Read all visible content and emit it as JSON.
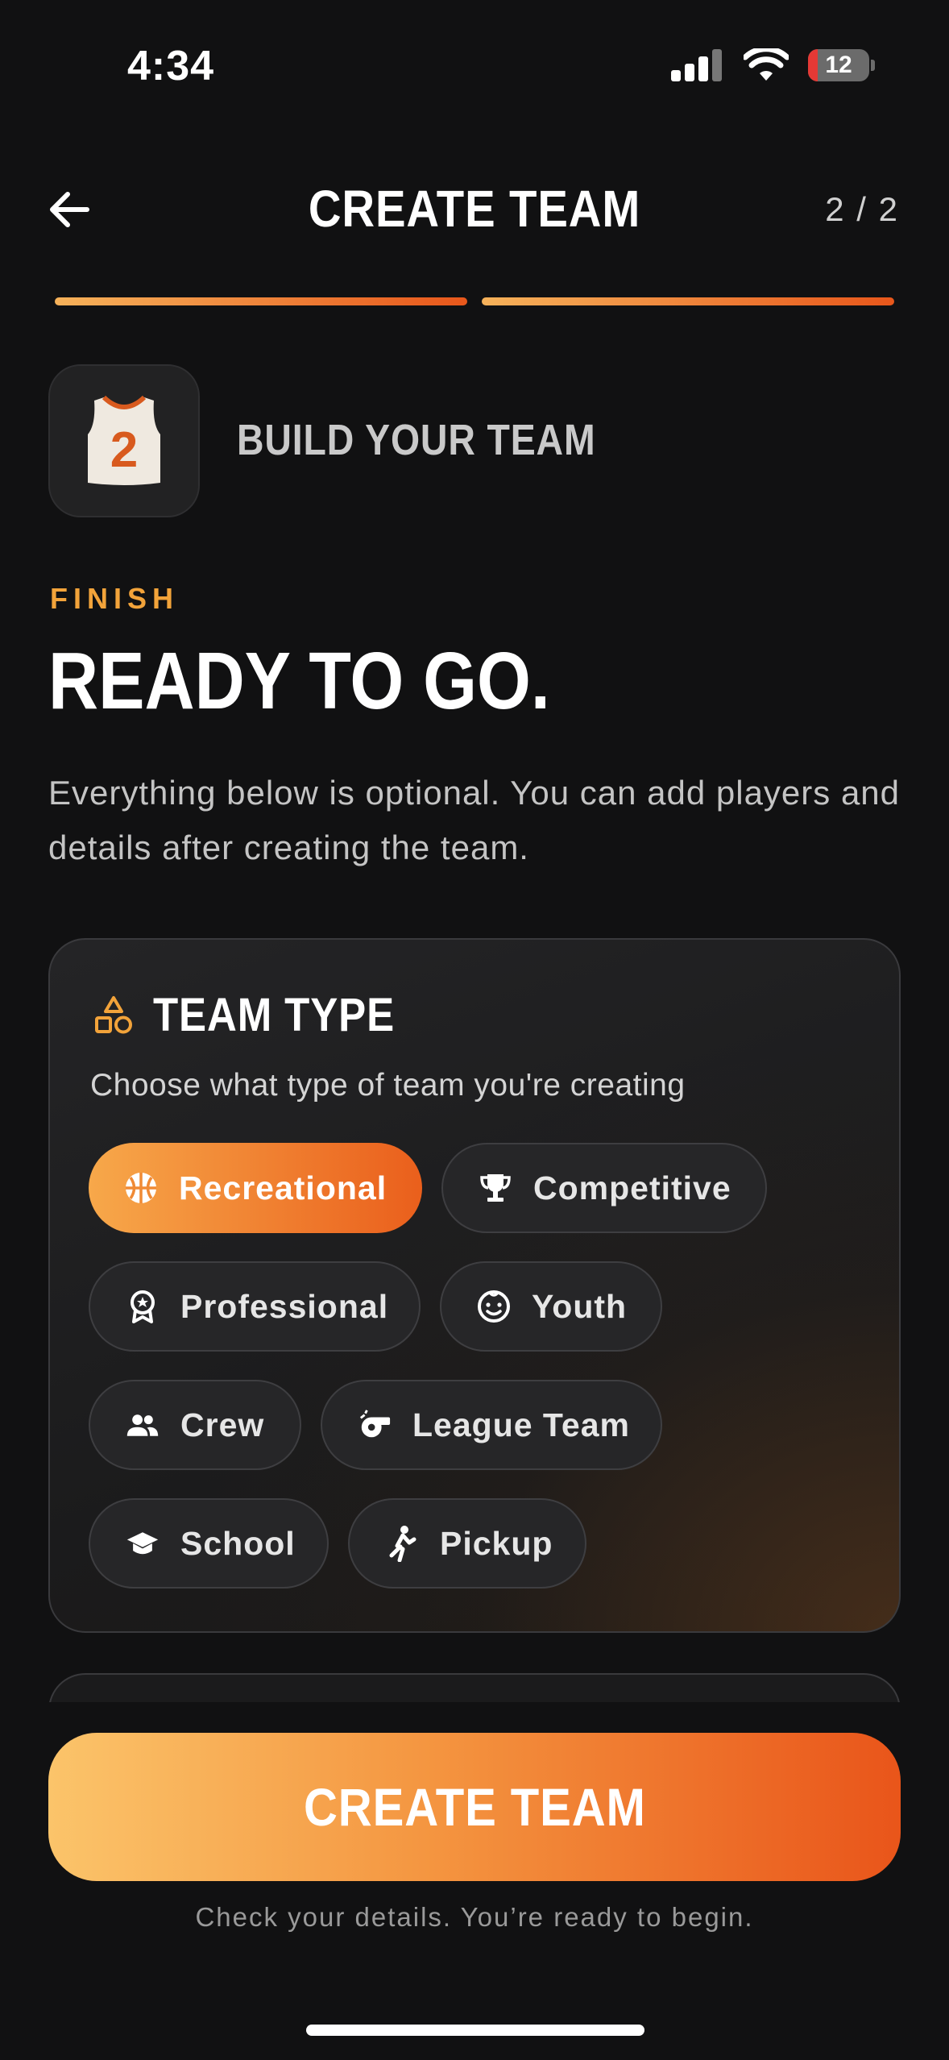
{
  "status_bar": {
    "time": "4:34",
    "battery": "12"
  },
  "header": {
    "title": "CREATE TEAM",
    "step": "2 / 2"
  },
  "intro": {
    "heading": "BUILD YOUR TEAM",
    "jersey_number": "2",
    "eyebrow": "FINISH",
    "headline": "READY TO GO.",
    "description": "Everything below is optional. You can add players and details after creating the team."
  },
  "team_type": {
    "title": "TEAM TYPE",
    "subtitle": "Choose what type of team you're creating",
    "selected": "Recreational",
    "options": [
      {
        "label": "Recreational",
        "icon": "basketball-icon"
      },
      {
        "label": "Competitive",
        "icon": "trophy-icon"
      },
      {
        "label": "Professional",
        "icon": "award-icon"
      },
      {
        "label": "Youth",
        "icon": "child-face-icon"
      },
      {
        "label": "Crew",
        "icon": "group-icon"
      },
      {
        "label": "League Team",
        "icon": "whistle-icon"
      },
      {
        "label": "School",
        "icon": "graduation-cap-icon"
      },
      {
        "label": "Pickup",
        "icon": "player-icon"
      }
    ]
  },
  "footer": {
    "cta_label": "CREATE TEAM",
    "hint": "Check your details. You’re ready to begin."
  },
  "colors": {
    "accent_start": "#f7a84a",
    "accent_end": "#ea5f1c",
    "eyebrow": "#f2a33a",
    "background": "#111112"
  }
}
